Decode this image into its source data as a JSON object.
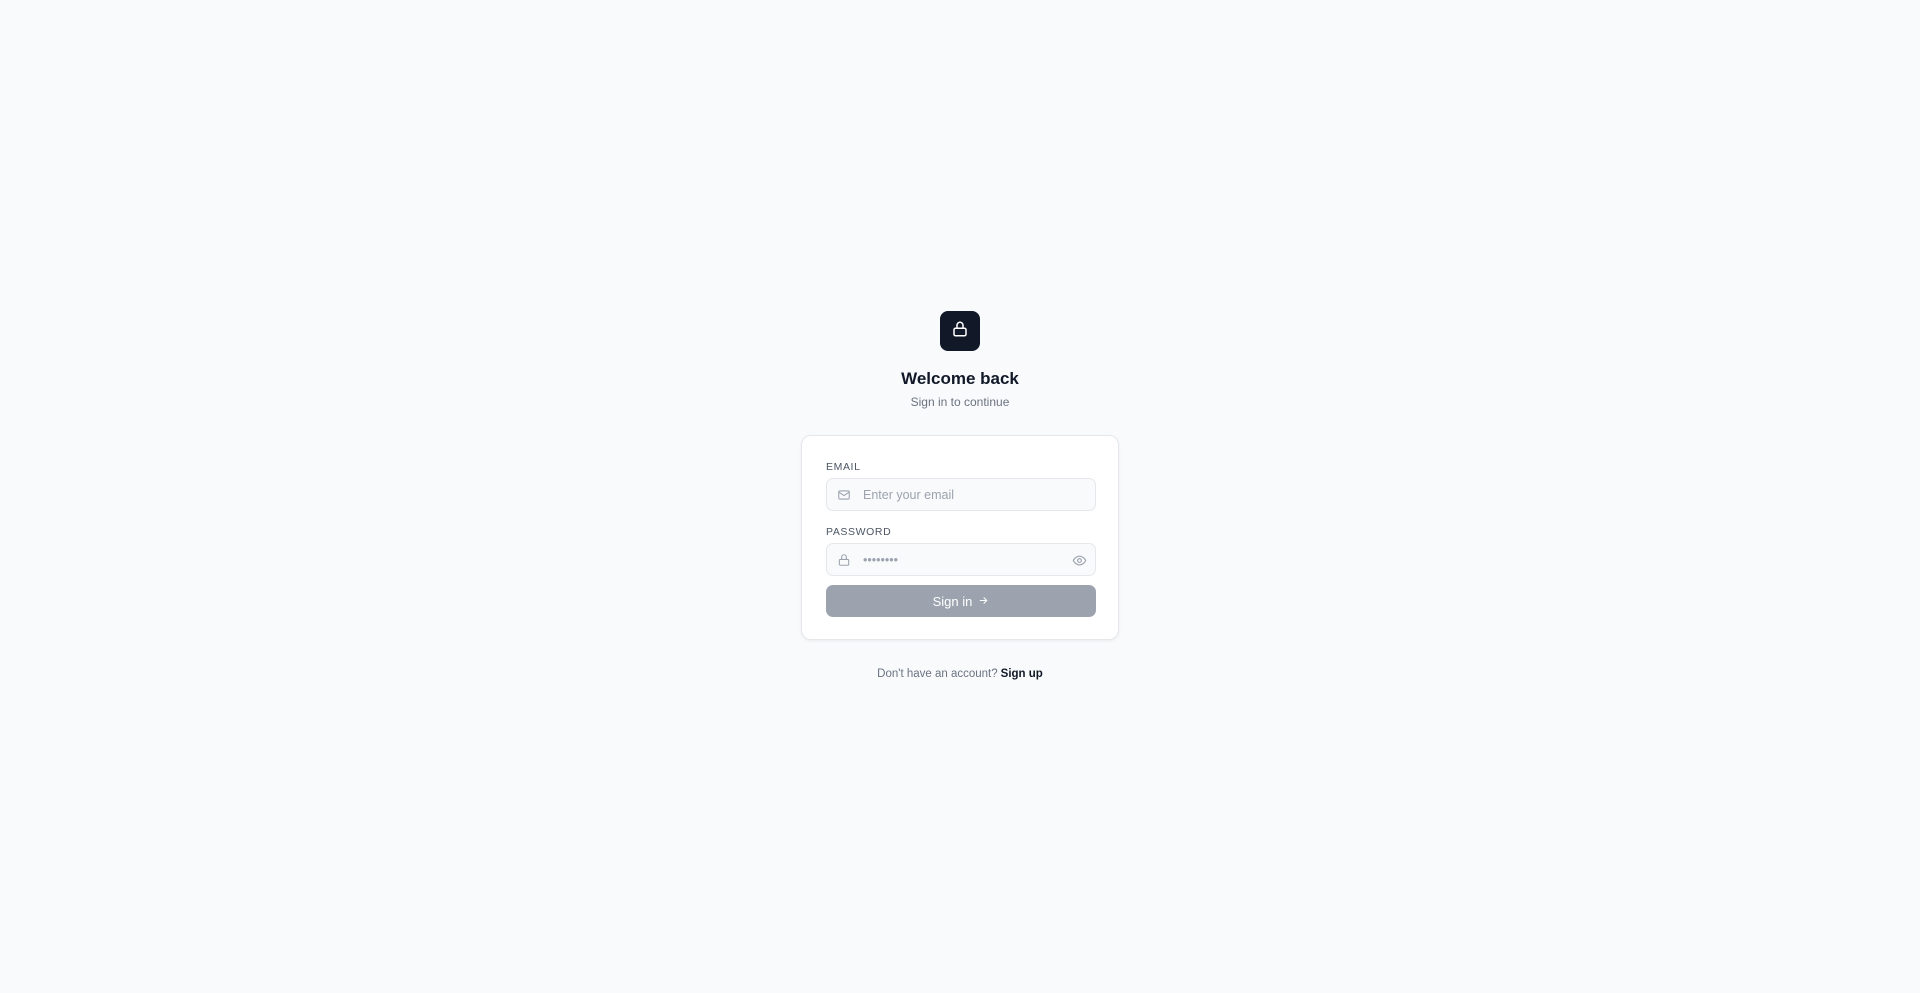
{
  "header": {
    "logo_icon": "lock-icon",
    "title": "Welcome back",
    "subtitle": "Sign in to continue"
  },
  "form": {
    "email": {
      "label": "EMAIL",
      "placeholder": "Enter your email",
      "value": "",
      "icon": "mail-icon"
    },
    "password": {
      "label": "PASSWORD",
      "placeholder": "••••••••",
      "value": "",
      "icon": "lock-icon",
      "toggle_icon": "eye-icon"
    },
    "submit_label": "Sign in",
    "submit_icon": "arrow-right-icon"
  },
  "footer": {
    "prompt": "Don't have an account?",
    "link_label": "Sign up"
  },
  "colors": {
    "background": "#f8fafc",
    "logo_tile": "#111827",
    "button_disabled": "#9ca3af",
    "text_primary": "#111827",
    "text_muted": "#6b7280"
  }
}
